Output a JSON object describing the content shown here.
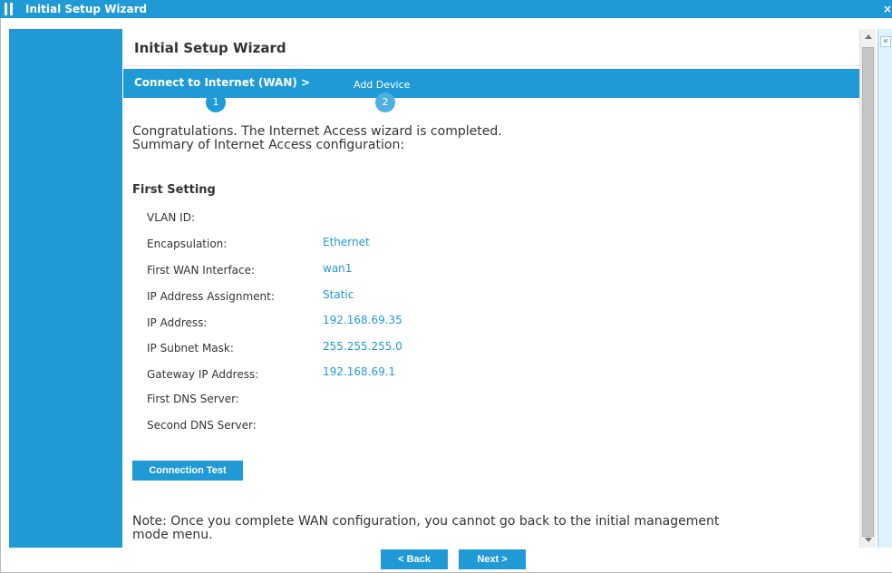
{
  "window": {
    "title": "Initial Setup Wizard",
    "close_label": "×"
  },
  "wizard": {
    "heading": "Initial Setup Wizard",
    "steps": [
      {
        "label": "Connect to Internet (WAN) >",
        "number": "1"
      },
      {
        "label": "Add Device",
        "number": "2"
      }
    ]
  },
  "message": {
    "line1": "Congratulations. The Internet Access wizard is completed.",
    "line2": "Summary of Internet Access configuration:"
  },
  "section": {
    "title": "First Setting",
    "rows": [
      {
        "label": "VLAN ID:",
        "value": ""
      },
      {
        "label": "Encapsulation:",
        "value": "Ethernet"
      },
      {
        "label": "First WAN Interface:",
        "value": "wan1"
      },
      {
        "label": "IP Address Assignment:",
        "value": "Static"
      },
      {
        "label": "IP Address:",
        "value": "192.168.69.35"
      },
      {
        "label": "IP Subnet Mask:",
        "value": "255.255.255.0"
      },
      {
        "label": "Gateway IP Address:",
        "value": "192.168.69.1"
      },
      {
        "label": "First DNS Server:",
        "value": ""
      },
      {
        "label": "Second DNS Server:",
        "value": ""
      }
    ]
  },
  "buttons": {
    "connection_test": "Connection Test",
    "back": "< Back",
    "next": "Next >"
  },
  "note": {
    "line1": "Note: Once you complete WAN configuration, you cannot go back to the initial management",
    "line2": "mode menu."
  },
  "right_panel": {
    "collapse_label": "«"
  },
  "colors": {
    "accent": "#1f9ad6",
    "value_text": "#1f9ad6"
  }
}
